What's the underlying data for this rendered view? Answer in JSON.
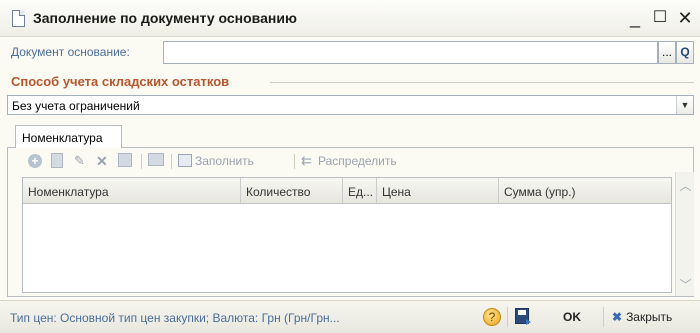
{
  "window": {
    "title": "Заполнение по документу основанию",
    "minimize": "_",
    "maximize": "☐",
    "close": "✕"
  },
  "doc_basis": {
    "label": "Документ основание:",
    "value": "",
    "select_btn": "...",
    "open_btn": "Q"
  },
  "stock_method": {
    "title": "Способ учета складских остатков",
    "value": "Без учета ограничений",
    "arrow": "▼"
  },
  "tabs": [
    {
      "label": "Номенклатура"
    }
  ],
  "toolbar": {
    "fill_label": "Заполнить",
    "distribute_label": "Распределить",
    "add_icon": "+",
    "delete_icon": "✕"
  },
  "table": {
    "columns": [
      "Номенклатура",
      "Количество",
      "Ед...",
      "Цена",
      "Сумма (упр.)"
    ],
    "rows": []
  },
  "scrollbar": {
    "up": "︿",
    "down": "﹀"
  },
  "statusbar": {
    "text": "Тип цен: Основной тип цен закупки; Валюта: Грн (Грн/Грн...",
    "help": "?",
    "ok_label": "OK",
    "close_label": "Закрыть",
    "close_icon": "✖"
  }
}
